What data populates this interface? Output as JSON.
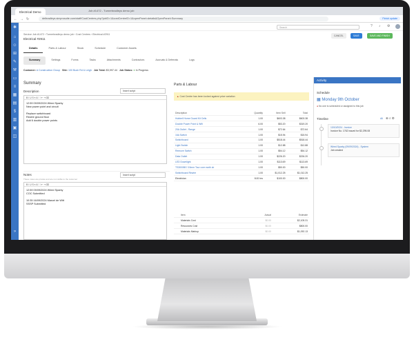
{
  "browser": {
    "tab_title": "Electrical Demo",
    "tab2_title": "Job #1472 - Turnerbradleys demo job",
    "url": "delbradleys.simprosuite.com/staff/CostCentres.php?jobID=1&costCentreID=1&openPanel=details&OpenPanel=Summary",
    "finish_label": "Finish update"
  },
  "app": {
    "search_placeholder": "Search",
    "breadcrumb": "Service Job #1472 › Turnerbradleys demo job › Cost Centres › Electrical #2911",
    "title": "Electrical #2911",
    "buttons": {
      "cancel": "CANCEL",
      "save": "SAVE",
      "save_finish": "SAVE AND FINISH"
    },
    "tabs1": [
      "Details",
      "Parts & Labour",
      "Stock",
      "Schedule",
      "Customer Assets"
    ],
    "tabs2": [
      "Summary",
      "Settings",
      "Forms",
      "Tasks",
      "Attachments",
      "Contractors",
      "Accruals & Deferrals",
      "Logs"
    ],
    "customer": {
      "label": "Customer:",
      "value": "A Construction Group",
      "site_label": "Site:",
      "site_value": "100 Bush Rd & Leigh",
      "total_label": "Job Total:",
      "total_value": "$3,997.44",
      "status_label": "Job Status:",
      "status_value": "In Progress"
    }
  },
  "summary": {
    "heading": "Summary",
    "description_label": "Description",
    "insert_script": "Insert script",
    "description_text": "12:59 09/09/2024 Wired Sparky\nNew power point and circuit\n\nReplace switchboard\nRewire ground floor\nAdd 6 double power points",
    "notes_label": "Notes",
    "notes_hint": "These notes are private and are not visible to the customer",
    "notes_text": "12:59 09/09/2024 Wired Sparky\nCOC Submitted\n\n10:35 16/09/2024 Marcel de Witt\nSSSP Submitted"
  },
  "parts": {
    "heading": "Parts & Labour",
    "warning": "Cost Centre has been locked against price variation",
    "columns": [
      "Description",
      "Quantity",
      "Item Sell",
      "Total"
    ],
    "rows": [
      [
        "Hubbell Home Guard Kit Cells",
        "1.00",
        "$603.38",
        "$603.38"
      ],
      [
        "Double Power Point & Wifi",
        "6.00",
        "$53.20",
        "$319.20"
      ],
      [
        "20A Outlet - Range",
        "1.00",
        "$72.64",
        "$72.64"
      ],
      [
        "16A Switch",
        "1.00",
        "$15.94",
        "$15.94"
      ],
      [
        "Switchboard",
        "1.00",
        "$518.44",
        "$518.44"
      ],
      [
        "Light Switch",
        "1.00",
        "$12.88",
        "$12.88"
      ],
      [
        "Remove Switch",
        "1.00",
        "$54.12",
        "$54.12"
      ],
      [
        "Data Outlet",
        "1.00",
        "$226.20",
        "$226.20"
      ],
      [
        "LED Downlight",
        "1.00",
        "$113.69",
        "$113.69"
      ],
      [
        "TS3000BG 3.5mm Tour core earth cb",
        "1.00",
        "$50.00",
        "$50.00"
      ],
      [
        "Switchboard Rewire",
        "1.00",
        "$1,012.25",
        "$1,012.25"
      ],
      [
        "Electrician",
        "8.00 hrs",
        "$100.00",
        "$800.00"
      ]
    ],
    "sub_columns": [
      "Item",
      "Actual",
      "Estimate"
    ],
    "sub_rows": [
      [
        "Materials Cost",
        "$0.00",
        "$2,105.31"
      ],
      [
        "Resources Cost",
        "$0.00",
        "$800.00"
      ],
      [
        "Materials Markup",
        "$0.00",
        "$1,092.13"
      ]
    ]
  },
  "activity": {
    "heading": "Activity",
    "schedule_label": "Schedule",
    "schedule_date": "Monday 9th October",
    "schedule_note": "No one is scheduled or assigned to this job",
    "timeline_label": "Timeline",
    "timeline_filter": "All",
    "events": [
      {
        "title": "13/10/2024 - Invoice",
        "body": "Invoice No. 1762 issued for $2,295.08"
      },
      {
        "title": "Wired Sparky (09/09/2024) - System",
        "body": "Job created"
      }
    ]
  },
  "colors": {
    "brand": "#3a75c4",
    "save": "#2e7cd6",
    "save_finish": "#5cb85c",
    "warning_bg": "#fcf3c0"
  }
}
